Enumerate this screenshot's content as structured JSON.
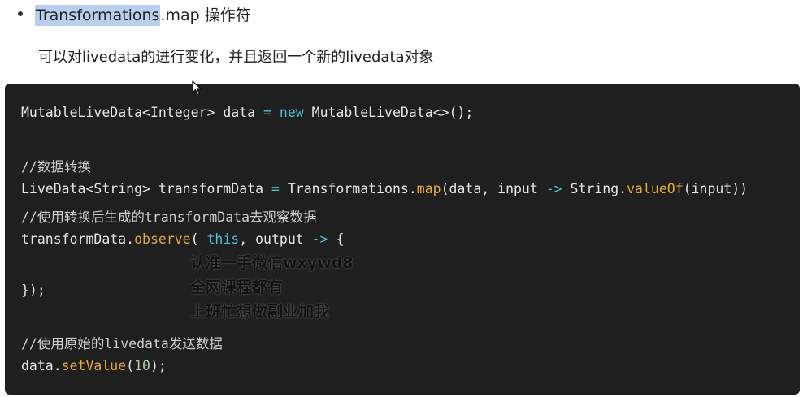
{
  "bullet": {
    "highlight": "Transformations",
    "rest": ".map 操作符"
  },
  "description": "可以对livedata的进行变化，并且返回一个新的livedata对象",
  "code": {
    "line1": {
      "a": "MutableLiveData<Integer> data ",
      "eq": "=",
      "sp": " ",
      "new": "new",
      "b": " MutableLiveData<>();"
    },
    "comment1": "//数据转换",
    "line2": {
      "a": "LiveData<String> transformData ",
      "eq": "=",
      "b": " Transformations.",
      "map": "map",
      "c": "(data, input ",
      "arrow": "->",
      "d": " String.",
      "valueOf": "valueOf",
      "e": "(input))"
    },
    "comment2": "//使用转换后生成的transformData去观察数据",
    "line3": {
      "a": "transformData.",
      "observe": "observe",
      "b": "( ",
      "this": "this",
      "c": ", output ",
      "arrow": "->",
      "d": " {"
    },
    "line4": "});",
    "comment3": "//使用原始的livedata发送数据",
    "line5": {
      "a": "data.",
      "setValue": "setValue",
      "b": "(",
      "num": "10",
      "c": ");"
    }
  },
  "watermark": {
    "line1": "认准一手微信wxywd8",
    "line2": "全网课程都有",
    "line3": "上班忙想做副业加我"
  }
}
